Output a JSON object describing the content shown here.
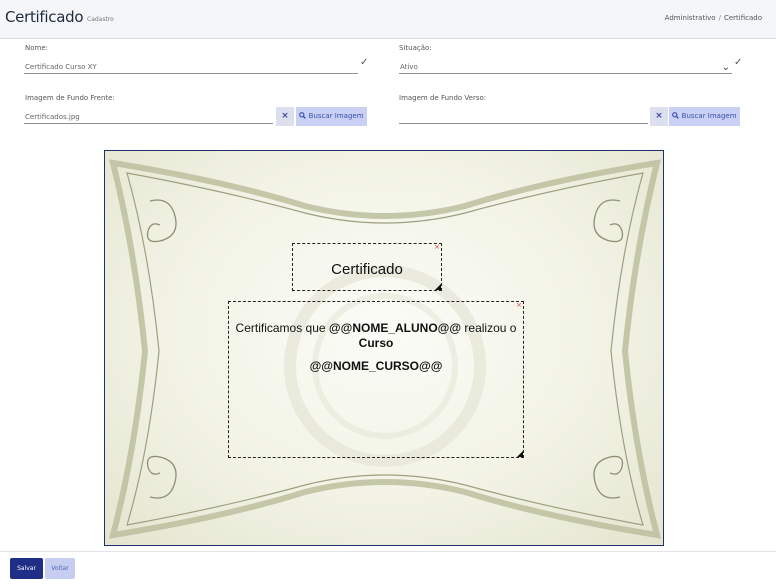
{
  "header": {
    "title": "Certificado",
    "subtitle": "Cadastro",
    "breadcrumb": [
      "Administrativo",
      "Certificado"
    ],
    "breadcrumb_separator": "/"
  },
  "form": {
    "nome": {
      "label": "Nome:",
      "value": "Certificado Curso XY"
    },
    "situacao": {
      "label": "Situação:",
      "value": "Ativo"
    },
    "fundo_frente": {
      "label": "Imagem de Fundo Frente:",
      "value": "Certificados.jpg",
      "clear_label": "×",
      "search_label": "Buscar Imagem"
    },
    "fundo_verso": {
      "label": "Imagem de Fundo Verso:",
      "value": "",
      "clear_label": "×",
      "search_label": "Buscar Imagem"
    }
  },
  "certificate": {
    "title_text": "Certificado",
    "body_prefix": "Certificamos que ",
    "body_name": "@@NOME_ALUNO@@",
    "body_middle": " realizou o ",
    "body_curso": "Curso",
    "body_course": "@@NOME_CURSO@@"
  },
  "footer": {
    "save_label": "Salvar",
    "back_label": "Voltar"
  },
  "colors": {
    "primary": "#1f2f87",
    "secondary": "#c6cdf1",
    "certificate_border": "#1f3070"
  },
  "icons": [
    "check-icon",
    "chevron-down-icon",
    "clear-icon",
    "search-icon",
    "close-icon",
    "resize-icon"
  ]
}
